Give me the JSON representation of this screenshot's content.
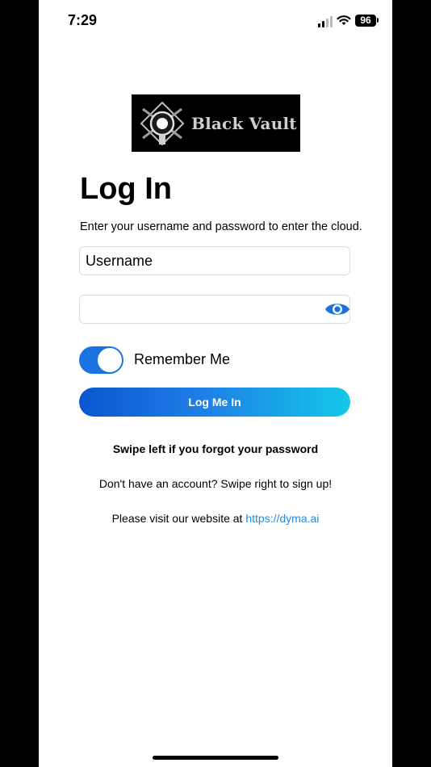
{
  "status_bar": {
    "time": "7:29",
    "battery": "96",
    "icons": [
      "signal-icon",
      "wifi-icon",
      "battery-icon"
    ]
  },
  "logo": {
    "text": "Black Vault",
    "icon": "vault-emblem-icon"
  },
  "login": {
    "title": "Log In",
    "subtitle": "Enter your username and password to enter the cloud.",
    "username_placeholder": "Username",
    "password_value": "",
    "password_toggle_icon": "eye-icon",
    "remember_label": "Remember Me",
    "remember_on": true,
    "button_label": "Log Me In"
  },
  "footer": {
    "forgot": "Swipe left if you forgot your password",
    "signup": "Don't have an account? Swipe right to sign up!",
    "website_prefix": "Please visit our website at",
    "website_link": "https://dyma.ai"
  },
  "colors": {
    "accent": "#1a73e0",
    "link": "#2489e0",
    "button_gradient_start": "#0a56d0",
    "button_gradient_end": "#13c8e8"
  }
}
